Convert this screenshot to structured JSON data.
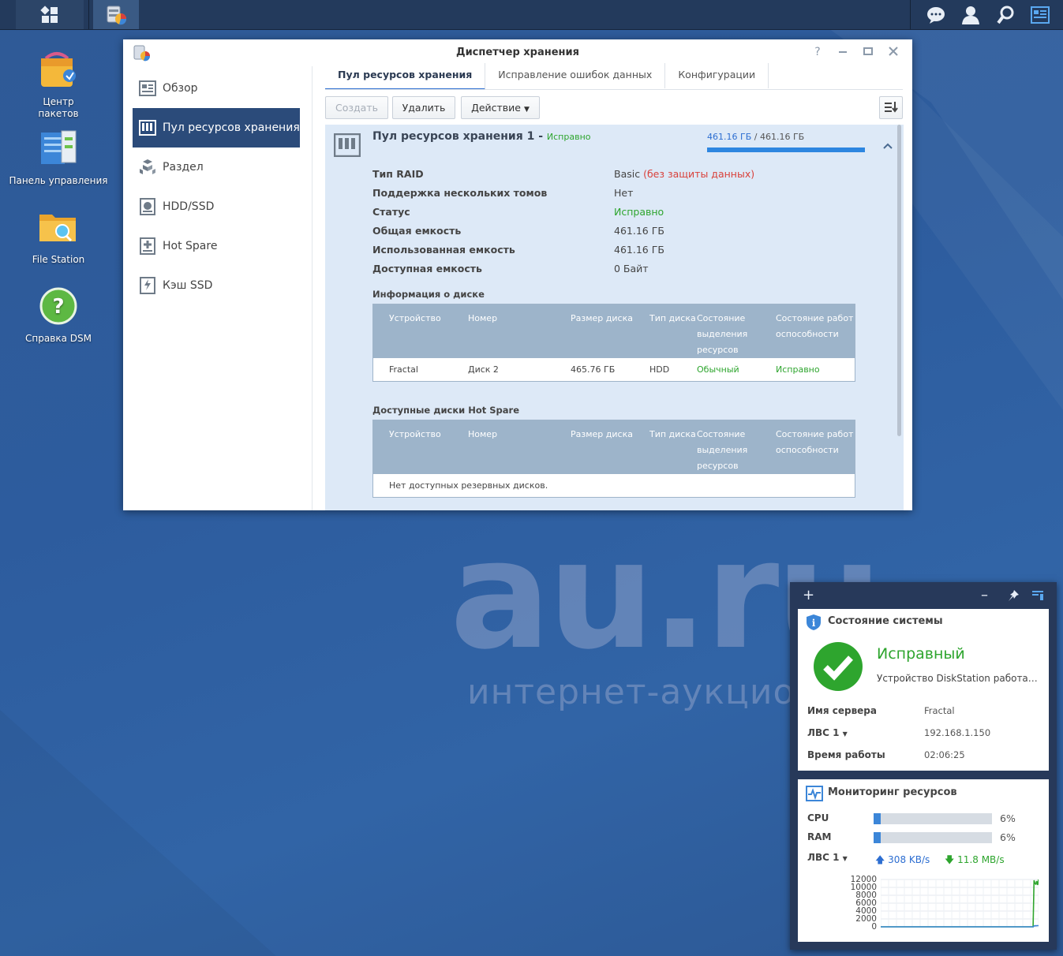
{
  "desktop": {
    "icons": [
      {
        "label": "Центр пакетов"
      },
      {
        "label": "Панель управления"
      },
      {
        "label": "File Station"
      },
      {
        "label": "Справка DSM"
      }
    ],
    "watermark": {
      "big": "au.ru",
      "small": "интернет-аукцион"
    }
  },
  "window": {
    "title": "Диспетчер хранения",
    "sidebar": [
      {
        "label": "Обзор",
        "icon": "overview-icon"
      },
      {
        "label": "Пул ресурсов хранения",
        "icon": "storage-pool-icon",
        "active": true
      },
      {
        "label": "Раздел",
        "icon": "volume-icon"
      },
      {
        "label": "HDD/SSD",
        "icon": "hdd-icon"
      },
      {
        "label": "Hot Spare",
        "icon": "hot-spare-icon"
      },
      {
        "label": "Кэш SSD",
        "icon": "ssd-cache-icon"
      }
    ],
    "tabs": [
      {
        "label": "Пул ресурсов хранения",
        "active": true
      },
      {
        "label": "Исправление ошибок данных"
      },
      {
        "label": "Конфигурации"
      }
    ],
    "toolbar": {
      "create": "Создать",
      "delete": "Удалить",
      "action": "Действие"
    },
    "pool": {
      "name": "Пул ресурсов хранения 1",
      "separator": "-",
      "status": "Исправно",
      "usage_used": "461.16 ГБ",
      "usage_sep": "/",
      "usage_total": "461.16 ГБ",
      "usage_fraction": 1.0,
      "props": [
        {
          "key": "Тип RAID",
          "value": "Basic",
          "note": "(без защиты данных)"
        },
        {
          "key": "Поддержка нескольких томов",
          "value": "Нет"
        },
        {
          "key": "Статус",
          "value": "Исправно"
        },
        {
          "key": "Общая емкость",
          "value": "461.16 ГБ"
        },
        {
          "key": "Использованная емкость",
          "value": "461.16 ГБ"
        },
        {
          "key": "Доступная емкость",
          "value": "0 Байт"
        }
      ],
      "disk_info": {
        "title": "Информация о диске",
        "headers": [
          "Устройство",
          "Номер",
          "Размер диска",
          "Тип диска",
          "Состояние выделения ресурсов",
          "Состояние работоспособности"
        ],
        "rows": [
          [
            "Fractal",
            "Диск 2",
            "465.76 ГБ",
            "HDD",
            "Обычный",
            "Исправно"
          ]
        ]
      },
      "hot_spare": {
        "title": "Доступные диски Hot Spare",
        "headers": [
          "Устройство",
          "Номер",
          "Размер диска",
          "Тип диска",
          "Состояние выделения ресурсов",
          "Состояние работоспособности"
        ],
        "empty": "Нет доступных резервных дисков."
      }
    }
  },
  "widget": {
    "system": {
      "title": "Состояние системы",
      "status": "Исправный",
      "desc": "Устройство DiskStation работа…",
      "rows": [
        {
          "key": "Имя сервера",
          "value": "Fractal"
        },
        {
          "key": "ЛВС 1",
          "value": "192.168.1.150"
        },
        {
          "key": "Время работы",
          "value": "02:06:25"
        }
      ]
    },
    "monitor": {
      "title": "Мониторинг ресурсов",
      "cpu_label": "CPU",
      "cpu_value": 6,
      "cpu_text": "6%",
      "ram_label": "RAM",
      "ram_value": 6,
      "ram_text": "6%",
      "lan_label": "ЛВС 1",
      "upload": "308 KB/s",
      "download": "11.8 MB/s"
    }
  },
  "chart_data": {
    "type": "line",
    "title": "",
    "xlabel": "",
    "ylabel": "",
    "yticks": [
      12000,
      10000,
      8000,
      6000,
      4000,
      2000,
      0
    ],
    "ylim": [
      0,
      12000
    ],
    "grid": true,
    "series": [
      {
        "values": [
          0,
          0,
          0,
          0,
          0,
          0,
          0,
          0,
          0,
          0,
          0,
          0,
          0,
          0,
          0,
          0,
          0,
          0,
          0,
          0,
          0,
          0,
          0,
          0,
          0,
          0,
          0,
          0,
          0,
          0,
          0,
          0,
          0,
          0,
          0,
          0,
          0,
          0,
          0,
          0,
          0,
          0,
          0,
          0,
          0,
          0,
          0,
          0,
          0,
          0,
          0,
          0,
          0,
          0,
          0,
          0,
          0,
          0,
          0,
          0,
          0,
          0,
          0,
          0,
          0,
          0,
          0,
          0,
          0,
          0,
          0,
          0,
          0,
          0,
          0,
          0,
          0,
          0,
          0,
          0,
          0,
          0,
          0,
          0,
          0,
          0,
          0,
          0,
          0,
          0,
          0,
          0,
          0,
          0,
          0,
          0,
          0,
          0,
          0,
          0,
          0,
          0,
          0,
          0,
          0,
          0,
          0,
          0,
          0,
          0,
          0,
          0,
          0,
          0,
          0,
          0,
          0,
          0,
          0,
          0,
          0,
          0,
          0,
          0,
          0,
          0,
          0,
          0,
          0,
          0,
          0,
          0,
          0,
          0,
          0,
          0,
          0,
          0,
          0,
          0,
          0,
          0,
          0,
          0,
          0,
          0,
          0,
          0,
          0,
          0,
          0,
          0,
          0,
          0,
          0,
          0,
          0,
          0,
          0,
          0,
          0,
          0,
          0,
          0,
          0,
          0,
          0,
          0,
          0,
          11800,
          11000,
          10800,
          11600,
          10600,
          12000
        ]
      },
      {
        "values": [
          0,
          0,
          0,
          0,
          0,
          0,
          0,
          0,
          0,
          0,
          0,
          0,
          0,
          0,
          0,
          0,
          0,
          0,
          0,
          0,
          0,
          0,
          0,
          0,
          0,
          0,
          0,
          0,
          0,
          0,
          0,
          0,
          0,
          0,
          0,
          0,
          0,
          0,
          0,
          0,
          0,
          0,
          0,
          0,
          0,
          0,
          0,
          0,
          0,
          0,
          0,
          0,
          0,
          0,
          0,
          0,
          0,
          0,
          0,
          0,
          0,
          0,
          0,
          0,
          0,
          0,
          0,
          0,
          0,
          0,
          0,
          0,
          0,
          0,
          0,
          0,
          0,
          0,
          0,
          0,
          0,
          0,
          0,
          0,
          0,
          0,
          0,
          0,
          0,
          0,
          0,
          0,
          0,
          0,
          0,
          0,
          0,
          0,
          0,
          0,
          0,
          0,
          0,
          0,
          0,
          0,
          0,
          0,
          0,
          0,
          0,
          0,
          0,
          0,
          0,
          0,
          0,
          0,
          0,
          0,
          0,
          0,
          0,
          0,
          0,
          0,
          0,
          0,
          0,
          0,
          0,
          0,
          0,
          0,
          0,
          0,
          0,
          0,
          0,
          0,
          0,
          0,
          0,
          0,
          0,
          0,
          0,
          0,
          0,
          0,
          0,
          0,
          0,
          0,
          0,
          0,
          0,
          0,
          0,
          0,
          0,
          0,
          0,
          0,
          0,
          0,
          0,
          0,
          0,
          0,
          200,
          300,
          250,
          300,
          300,
          300
        ]
      }
    ],
    "colors": [
      "#2ea52e",
      "#3c86d8"
    ]
  }
}
